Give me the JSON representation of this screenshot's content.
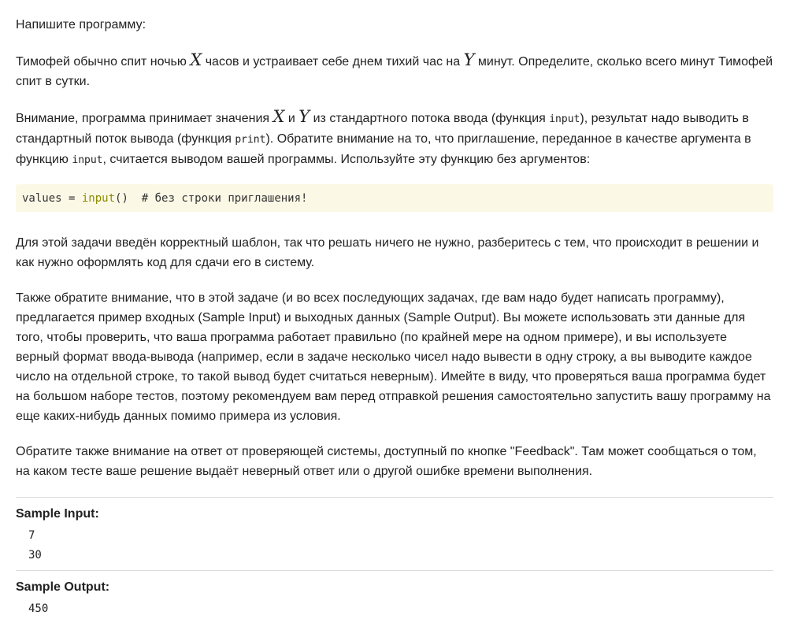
{
  "task": {
    "intro": "Напишите программу:",
    "p1": {
      "a": "Тимофей обычно спит ночью ",
      "var_x": "X",
      "b": " часов и устраивает себе днем тихий час на ",
      "var_y": "Y",
      "c": " минут. Определите, сколько всего минут Тимофей спит в сутки."
    },
    "p2": {
      "a": "Внимание, программа принимает значения ",
      "var_x": "X",
      "and": " и ",
      "var_y": "Y",
      "b": " из стандартного потока ввода (функция ",
      "code_input": "input",
      "c": "), результат надо выводить в стандартный поток вывода (функция ",
      "code_print": "print",
      "d": "). Обратите внимание на то, что приглашение, переданное в качестве аргумента в функцию ",
      "code_input2": "input",
      "e": ", считается выводом вашей программы. Используйте эту функцию без аргументов:"
    },
    "code": {
      "var": "values",
      "eq": " = ",
      "func": "input",
      "parens": "()",
      "comment": "  # без строки приглашения!"
    },
    "p3": "Для этой задачи введён корректный шаблон, так что решать ничего не нужно, разберитесь с тем, что происходит в решении и как нужно оформлять код для сдачи его в систему.",
    "p4": "Также обратите внимание, что в этой задаче (и во всех последующих задачах, где вам надо будет написать программу), предлагается пример входных (Sample Input) и выходных данных (Sample Output). Вы можете использовать эти данные для того, чтобы проверить, что ваша программа работает правильно (по крайней мере на одном примере), и вы используете верный формат ввода-вывода (например, если в задаче несколько чисел надо вывести в одну строку, а вы выводите каждое число на отдельной строке, то такой вывод будет считаться неверным). Имейте в виду, что проверяться ваша программа будет на большом наборе тестов, поэтому рекомендуем вам перед отправкой решения самостоятельно запустить вашу программу на еще каких-нибудь данных помимо примера из условия.",
    "p5": "Обратите также внимание на ответ от проверяющей системы, доступный по кнопке \"Feedback\". Там может сообщаться о том, на каком тесте ваше решение выдаёт неверный ответ или о другой ошибке времени выполнения."
  },
  "samples": {
    "input_title": "Sample Input:",
    "input_lines": [
      "7",
      "30"
    ],
    "output_title": "Sample Output:",
    "output_lines": [
      "450"
    ]
  },
  "colors": {
    "code_background": "#fcf8e6",
    "builtin_token": "#8c8c00",
    "divider": "#dcdcdc",
    "text": "#222222"
  }
}
